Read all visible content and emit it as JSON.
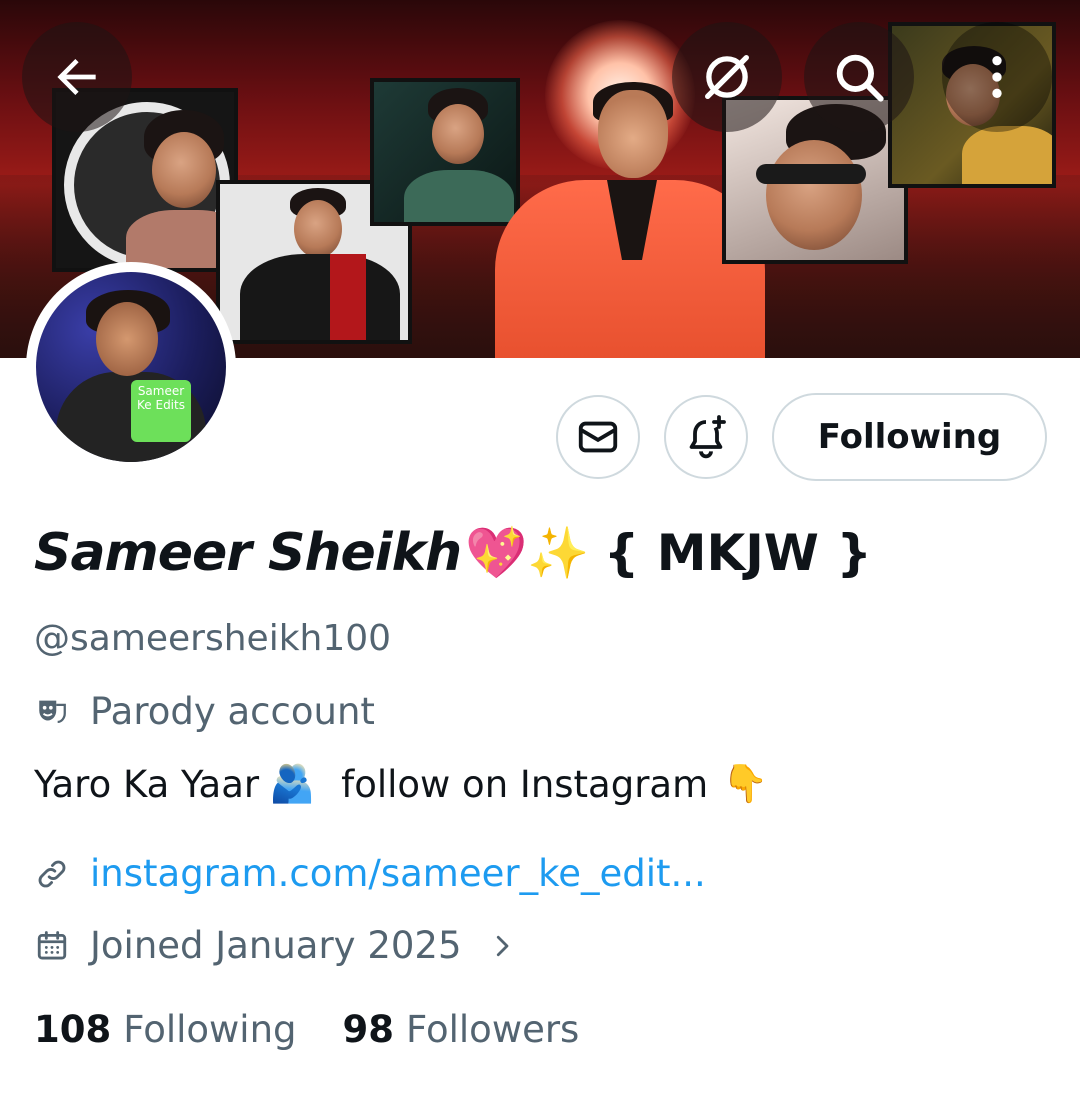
{
  "header": {
    "back_icon": "arrow-left-icon",
    "grok_icon": "slash-circle-icon",
    "search_icon": "search-icon",
    "more_icon": "more-vertical-icon"
  },
  "actions": {
    "message_icon": "mail-icon",
    "notify_icon": "bell-plus-icon",
    "follow_label": "Following"
  },
  "profile": {
    "display_name": "Sameer Sheikh",
    "name_emoji": "💖✨",
    "name_tag": "{ MKJW }",
    "handle": "@sameersheikh100",
    "parody_label": "Parody account",
    "bio_text_1": "Yaro Ka Yaar",
    "bio_emoji_1": "🫂",
    "bio_text_2": "follow on Instagram",
    "bio_emoji_2": "👇",
    "link": "instagram.com/sameer_ke_edit...",
    "joined": "Joined January 2025",
    "avatar_tag": "Sameer Ke Edits"
  },
  "stats": {
    "following_count": "108",
    "following_label": "Following",
    "followers_count": "98",
    "followers_label": "Followers"
  },
  "colors": {
    "accent": "#1d9bf0",
    "secondary_text": "#536471",
    "border": "#cfd9de"
  }
}
